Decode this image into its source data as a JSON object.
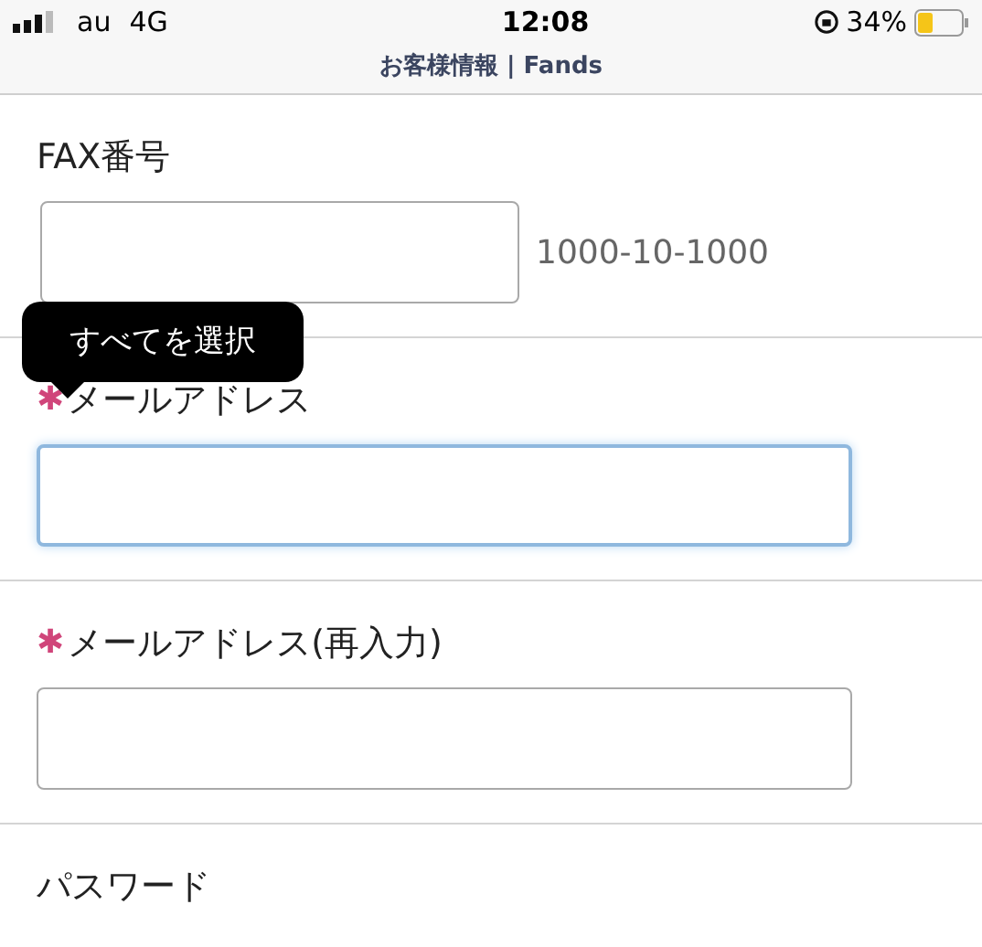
{
  "status_bar": {
    "carrier": "au",
    "network": "4G",
    "time": "12:08",
    "battery": "34%"
  },
  "header": {
    "title": "お客様情報 | Fands"
  },
  "fields": [
    {
      "kind": "short",
      "label": "FAX番号",
      "hint": "1000-10-1000",
      "focused": false
    },
    {
      "kind": "full",
      "mark": "✱",
      "label": "メールアドレス",
      "focused": true
    },
    {
      "kind": "full",
      "mark": "✱",
      "label": "メールアドレス(再入力)",
      "focused": false
    },
    {
      "kind": "label",
      "label": "パスワード"
    }
  ],
  "tooltip": {
    "text": "すべてを選択"
  }
}
